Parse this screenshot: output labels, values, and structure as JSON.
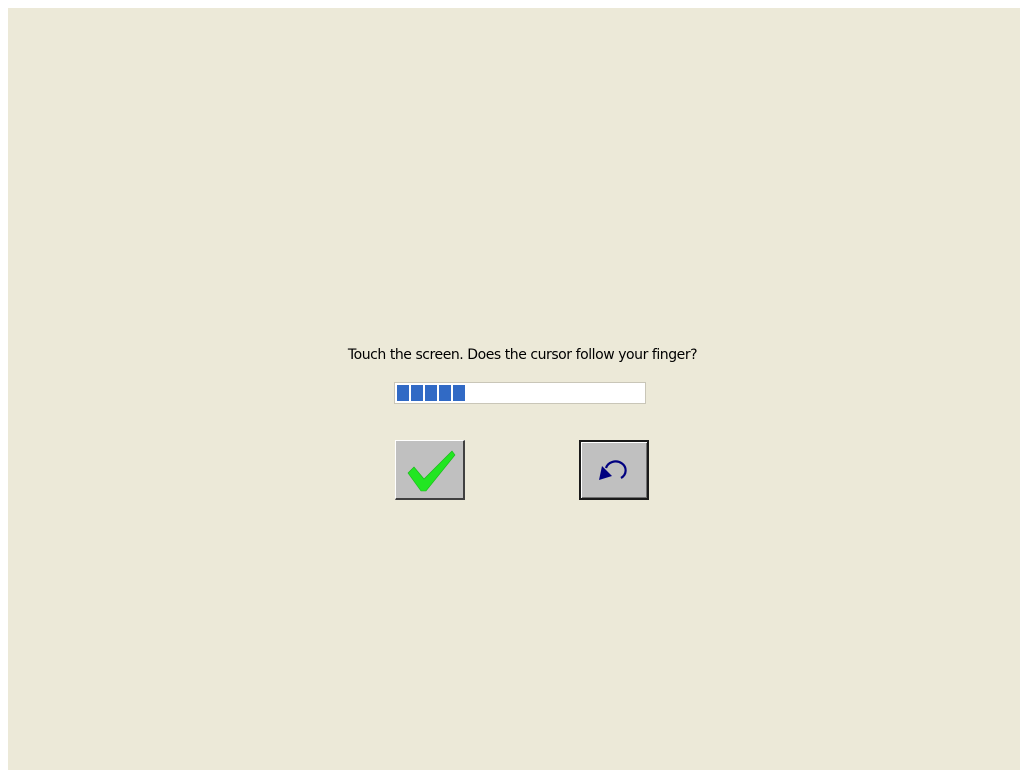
{
  "dialog": {
    "prompt": "Touch the screen. Does the cursor follow your finger?"
  },
  "progress": {
    "filled_blocks": 5,
    "total_blocks": 18,
    "fraction": 0.28,
    "color": "#316ac5"
  },
  "buttons": {
    "confirm": {
      "icon": "checkmark-icon",
      "color": "#22e622"
    },
    "retry": {
      "icon": "undo-arrow-icon",
      "color": "#000080"
    }
  },
  "colors": {
    "background": "#ece9d8",
    "button_face": "#c0c0c0"
  }
}
